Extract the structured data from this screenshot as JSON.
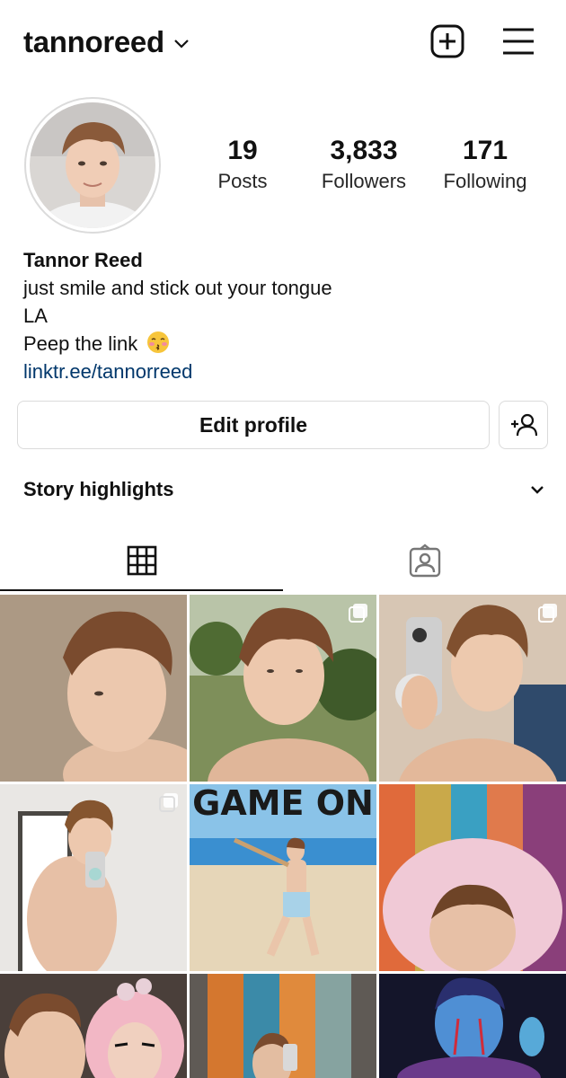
{
  "header": {
    "username": "tannoreed",
    "icons": [
      "chevron-down-icon",
      "new-post-icon",
      "menu-icon"
    ]
  },
  "profile": {
    "stats": [
      {
        "value": "19",
        "label": "Posts"
      },
      {
        "value": "3,833",
        "label": "Followers"
      },
      {
        "value": "171",
        "label": "Following"
      }
    ],
    "name": "Tannor Reed",
    "bio_lines": [
      "just smile and stick out your tongue",
      "LA",
      "Peep the link"
    ],
    "link": "linktr.ee/tannorreed"
  },
  "actions": {
    "edit_label": "Edit profile"
  },
  "highlights": {
    "label": "Story highlights"
  },
  "tabs": [
    "grid-tab",
    "tagged-tab"
  ],
  "grid": {
    "post_overlay_text": "GAME ON",
    "colors": {
      "link": "#00376b",
      "border": "#dbdbdb"
    }
  }
}
